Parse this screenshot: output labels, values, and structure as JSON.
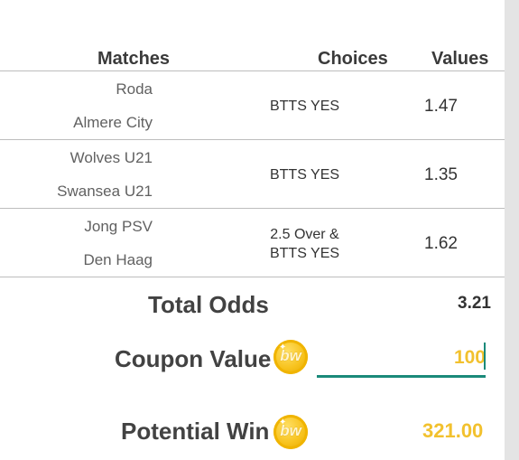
{
  "table": {
    "headers": {
      "matches": "Matches",
      "choices": "Choices",
      "values": "Values"
    },
    "rows": [
      {
        "home": "Roda",
        "away": "Almere City",
        "choice_line1": "BTTS YES",
        "choice_line2": "",
        "value": "1.47"
      },
      {
        "home": "Wolves U21",
        "away": "Swansea U21",
        "choice_line1": "BTTS YES",
        "choice_line2": "",
        "value": "1.35"
      },
      {
        "home": "Jong PSV",
        "away": "Den Haag",
        "choice_line1": "2.5 Over &",
        "choice_line2": "BTTS YES",
        "value": "1.62"
      }
    ]
  },
  "summary": {
    "total_odds_label": "Total Odds",
    "total_odds_value": "3.21",
    "coupon_value_label": "Coupon Value",
    "coupon_value_input": "100",
    "potential_win_label": "Potential Win",
    "potential_win_value": "321.00",
    "coin_text": "bw"
  },
  "colors": {
    "accent_teal": "#1a8a7a",
    "amount_yellow": "#f2c12e",
    "coin_gold": "#f7c21c"
  },
  "icons": {
    "coin": "bw-coin-icon"
  }
}
